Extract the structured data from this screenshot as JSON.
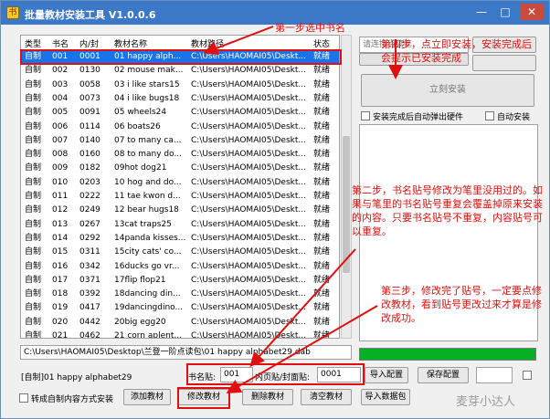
{
  "window": {
    "title": "批量教材安装工具 V1.0.0.6",
    "min_glyph": "—",
    "max_glyph": "□",
    "close_glyph": "✕"
  },
  "list": {
    "headers": [
      "类型",
      "书名",
      "内/封",
      "教材名称",
      "教材路径",
      "状态"
    ],
    "rows": [
      [
        "自制",
        "001",
        "0001",
        "01 happy alph...",
        "C:\\Users\\HAOMAI05\\Deskt...",
        "就绪"
      ],
      [
        "自制",
        "002",
        "0130",
        "02 mouse mak...",
        "C:\\Users\\HAOMAI05\\Deskt...",
        "就绪"
      ],
      [
        "自制",
        "003",
        "0058",
        "03 i like stars15",
        "C:\\Users\\HAOMAI05\\Deskt...",
        "就绪"
      ],
      [
        "自制",
        "004",
        "0073",
        "04 i like bugs18",
        "C:\\Users\\HAOMAI05\\Deskt...",
        "就绪"
      ],
      [
        "自制",
        "005",
        "0091",
        "05 wheels24",
        "C:\\Users\\HAOMAI05\\Deskt...",
        "就绪"
      ],
      [
        "自制",
        "006",
        "0114",
        "06 boats26",
        "C:\\Users\\HAOMAI05\\Deskt...",
        "就绪"
      ],
      [
        "自制",
        "007",
        "0140",
        "07 to many ca...",
        "C:\\Users\\HAOMAI05\\Deskt...",
        "就绪"
      ],
      [
        "自制",
        "008",
        "0160",
        "08 to many do...",
        "C:\\Users\\HAOMAI05\\Deskt...",
        "就绪"
      ],
      [
        "自制",
        "009",
        "0182",
        "09hot dog21",
        "C:\\Users\\HAOMAI05\\Deskt...",
        "就绪"
      ],
      [
        "自制",
        "010",
        "0203",
        "10 hog and do...",
        "C:\\Users\\HAOMAI05\\Deskt...",
        "就绪"
      ],
      [
        "自制",
        "011",
        "0222",
        "11 tae kwon d...",
        "C:\\Users\\HAOMAI05\\Deskt...",
        "就绪"
      ],
      [
        "自制",
        "012",
        "0249",
        "12 bear hugs18",
        "C:\\Users\\HAOMAI05\\Deskt...",
        "就绪"
      ],
      [
        "自制",
        "013",
        "0267",
        "13cat traps25",
        "C:\\Users\\HAOMAI05\\Deskt...",
        "就绪"
      ],
      [
        "自制",
        "014",
        "0292",
        "14panda kisses...",
        "C:\\Users\\HAOMAI05\\Deskt...",
        "就绪"
      ],
      [
        "自制",
        "015",
        "0311",
        "15city cats' co...",
        "C:\\Users\\HAOMAI05\\Deskt...",
        "就绪"
      ],
      [
        "自制",
        "016",
        "0342",
        "16ducks go vr...",
        "C:\\Users\\HAOMAI05\\Deskt...",
        "就绪"
      ],
      [
        "自制",
        "017",
        "0371",
        "17flip flop21",
        "C:\\Users\\HAOMAI05\\Deskt...",
        "就绪"
      ],
      [
        "自制",
        "018",
        "0392",
        "18dancing din...",
        "C:\\Users\\HAOMAI05\\Deskt...",
        "就绪"
      ],
      [
        "自制",
        "019",
        "0417",
        "19dancingdino...",
        "C:\\Users\\HAOMAI05\\Deskt...",
        "就绪"
      ],
      [
        "自制",
        "020",
        "0442",
        "20big egg20",
        "C:\\Users\\HAOMAI05\\Deskt...",
        "就绪"
      ],
      [
        "自制",
        "021",
        "0462",
        "21 corn aplent...",
        "C:\\Users\\HAOMAI05\\Deskt...",
        "就绪"
      ]
    ]
  },
  "path_value": "C:\\Users\\HAOMAI05\\Desktop\\兰登一阶点读包\\01 happy alphabet29.dab",
  "right": {
    "pen_placeholder": "请连接点读笔",
    "install_button": "立刻安装",
    "auto_eject_label": "安装完成后自动弹出硬件",
    "auto_install_label": "自动安装"
  },
  "bottom": {
    "selected_name": "[自制]01 happy alphabet29",
    "book_label": "书名贴:",
    "book_value": "001",
    "inner_label": "内页贴/封面贴:",
    "inner_value": "0001",
    "import_config": "导入配置",
    "save_config": "保存配置",
    "convert_label": "转成自制内容方式安装",
    "add": "添加教材",
    "modify": "修改教材",
    "delete": "删除教材",
    "clear": "清空教材",
    "import_pack": "导入数据包"
  },
  "annotations": {
    "step1": "第一步选中书名",
    "step4": "第四步，点立即安装，安装完成后会提示已安装完成",
    "step2": "第二步，书名贴号修改为笔里没用过的。如果与笔里的书名贴号重复会覆盖掉原来安装的内容。只要书名贴号不重复，内容贴号可以重复。",
    "step3": "第三步，修改完了贴号，一定要点修改教材，看到贴号更改过来才算是修改成功。"
  },
  "watermark": "麦芽小达人"
}
